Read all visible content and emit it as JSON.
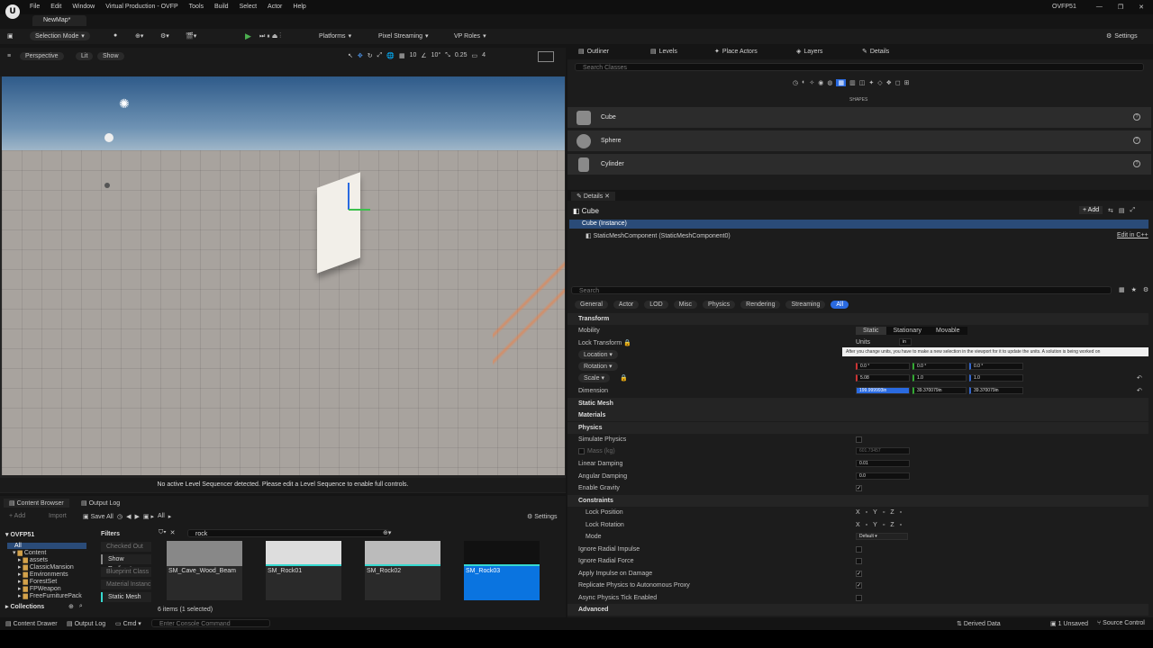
{
  "app": {
    "project": "OVFP51",
    "tab": "NewMap*",
    "logo": "U"
  },
  "menu": [
    "File",
    "Edit",
    "Window",
    "Virtual Production - OVFP",
    "Tools",
    "Build",
    "Select",
    "Actor",
    "Help"
  ],
  "toolbar": {
    "selection_mode": "Selection Mode",
    "platforms": "Platforms",
    "pixel_streaming": "Pixel Streaming",
    "vp_roles": "VP Roles",
    "settings": "Settings"
  },
  "viewport": {
    "perspective": "Perspective",
    "lit": "Lit",
    "show": "Show",
    "grid": "10",
    "angle": "10°",
    "scale": "0.25",
    "cam": "4",
    "message": "No active Level Sequencer detected. Please edit a Level Sequence to enable full controls."
  },
  "tabs": {
    "outliner": "Outliner",
    "levels": "Levels",
    "place_actors": "Place Actors",
    "layers": "Layers",
    "details": "Details"
  },
  "place_actors": {
    "search_placeholder": "Search Classes",
    "category": "SHAPES",
    "items": [
      "Cube",
      "Sphere",
      "Cylinder"
    ]
  },
  "details": {
    "tab": "Details",
    "actor": "Cube",
    "add": "+ Add",
    "instance": "Cube (Instance)",
    "component": "StaticMeshComponent (StaticMeshComponent0)",
    "edit_cpp": "Edit in C++",
    "search_placeholder": "Search",
    "filters": [
      "General",
      "Actor",
      "LOD",
      "Misc",
      "Physics",
      "Rendering",
      "Streaming",
      "All"
    ],
    "transform": "Transform",
    "mobility": "Mobility",
    "mobility_options": [
      "Static",
      "Stationary",
      "Movable"
    ],
    "lock_transform": "Lock Transform",
    "units_label": "Units",
    "units_value": "in",
    "tooltip": "After you change units, you have to make a new selection in the viewport for it to update the units. A solution is being worked on",
    "location": "Location",
    "rotation": "Rotation",
    "scale": "Scale",
    "dimension": "Dimension",
    "rotation_values": [
      "0.0 °",
      "0.0 °",
      "0.0 °"
    ],
    "scale_values": [
      "5.08",
      "1.0",
      "1.0"
    ],
    "dimension_values": [
      "199.999993in",
      "39.370079in",
      "39.370079in"
    ],
    "sections": {
      "static_mesh": "Static Mesh",
      "materials": "Materials",
      "physics": "Physics",
      "constraints": "Constraints",
      "advanced": "Advanced"
    },
    "physics_rows": {
      "simulate": "Simulate Physics",
      "mass": "Mass (kg)",
      "mass_value": "601.73457",
      "linear": "Linear Damping",
      "linear_value": "0.01",
      "angular": "Angular Damping",
      "angular_value": "0.0",
      "gravity": "Enable Gravity"
    },
    "constraints": {
      "lock_position": "Lock Position",
      "lock_rotation": "Lock Rotation",
      "mode": "Mode",
      "mode_value": "Default",
      "axes": [
        "X",
        "Y",
        "Z"
      ]
    },
    "misc_rows": [
      "Ignore Radial Impulse",
      "Ignore Radial Force",
      "Apply Impulse on Damage",
      "Replicate Physics to Autonomous Proxy",
      "Async Physics Tick Enabled"
    ]
  },
  "content_browser": {
    "tab": "Content Browser",
    "output_log": "Output Log",
    "add": "+ Add",
    "import": "Import",
    "save_all": "Save All",
    "path": "All",
    "settings": "Settings",
    "search": "rock",
    "tree": [
      "OVFP51",
      "All",
      "Content",
      "assets",
      "ClassicMansion",
      "Environments",
      "ForestSet",
      "FPWeapon",
      "FreeFurniturePack"
    ],
    "collections": "Collections",
    "filters_title": "Filters",
    "filters": [
      "Checked Out",
      "Show Redirector",
      "Blueprint Class",
      "Material Instanc",
      "Static Mesh"
    ],
    "assets": [
      "SM_Cave_Wood_Beam",
      "SM_Rock01",
      "SM_Rock02",
      "SM_Rock03"
    ],
    "count": "6 items (1 selected)"
  },
  "statusbar": {
    "content_drawer": "Content Drawer",
    "output_log": "Output Log",
    "cmd": "Cmd",
    "console_placeholder": "Enter Console Command",
    "derived_data": "Derived Data",
    "unsaved": "1 Unsaved",
    "source_control": "Source Control"
  }
}
